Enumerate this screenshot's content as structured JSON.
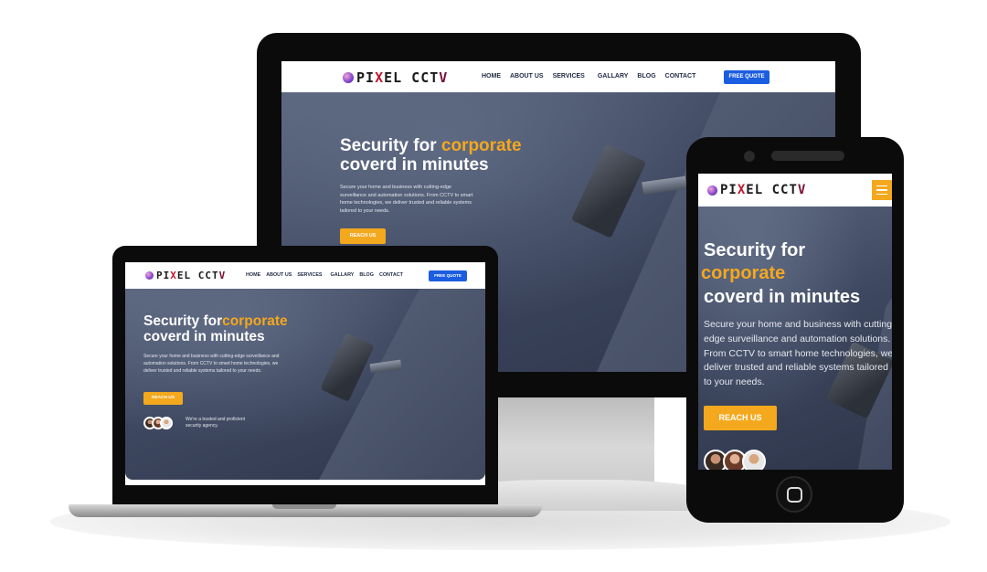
{
  "brand": {
    "logo_prefix": "PI",
    "logo_x": "X",
    "logo_mid": "EL CCT",
    "logo_v": "V"
  },
  "nav": {
    "home": "HOME",
    "about": "ABOUT US",
    "services": "SERVICES",
    "gallery": "GALLARY",
    "blog": "BLOG",
    "contact": "CONTACT",
    "quote": "FREE QUOTE"
  },
  "hero": {
    "title_start": "Security for",
    "title_accent": "corporate",
    "title_end": "coverd in minutes",
    "description": "Secure your home and business with cutting-edge surveillance and automation solutions. From CCTV to smart home technologies, we deliver trusted and reliable systems tailored to your needs.",
    "cta": "REACH US",
    "trusted": "We're a trusted and proficient security agency."
  },
  "colors": {
    "accent": "#f4a81d",
    "quote_button": "#1b5de0",
    "hero_bg": "#3d475f",
    "device": "#0b0b0b"
  },
  "icons": [
    "logo-badge-icon",
    "camera-icon",
    "hamburger-menu-icon",
    "home-button-icon"
  ]
}
